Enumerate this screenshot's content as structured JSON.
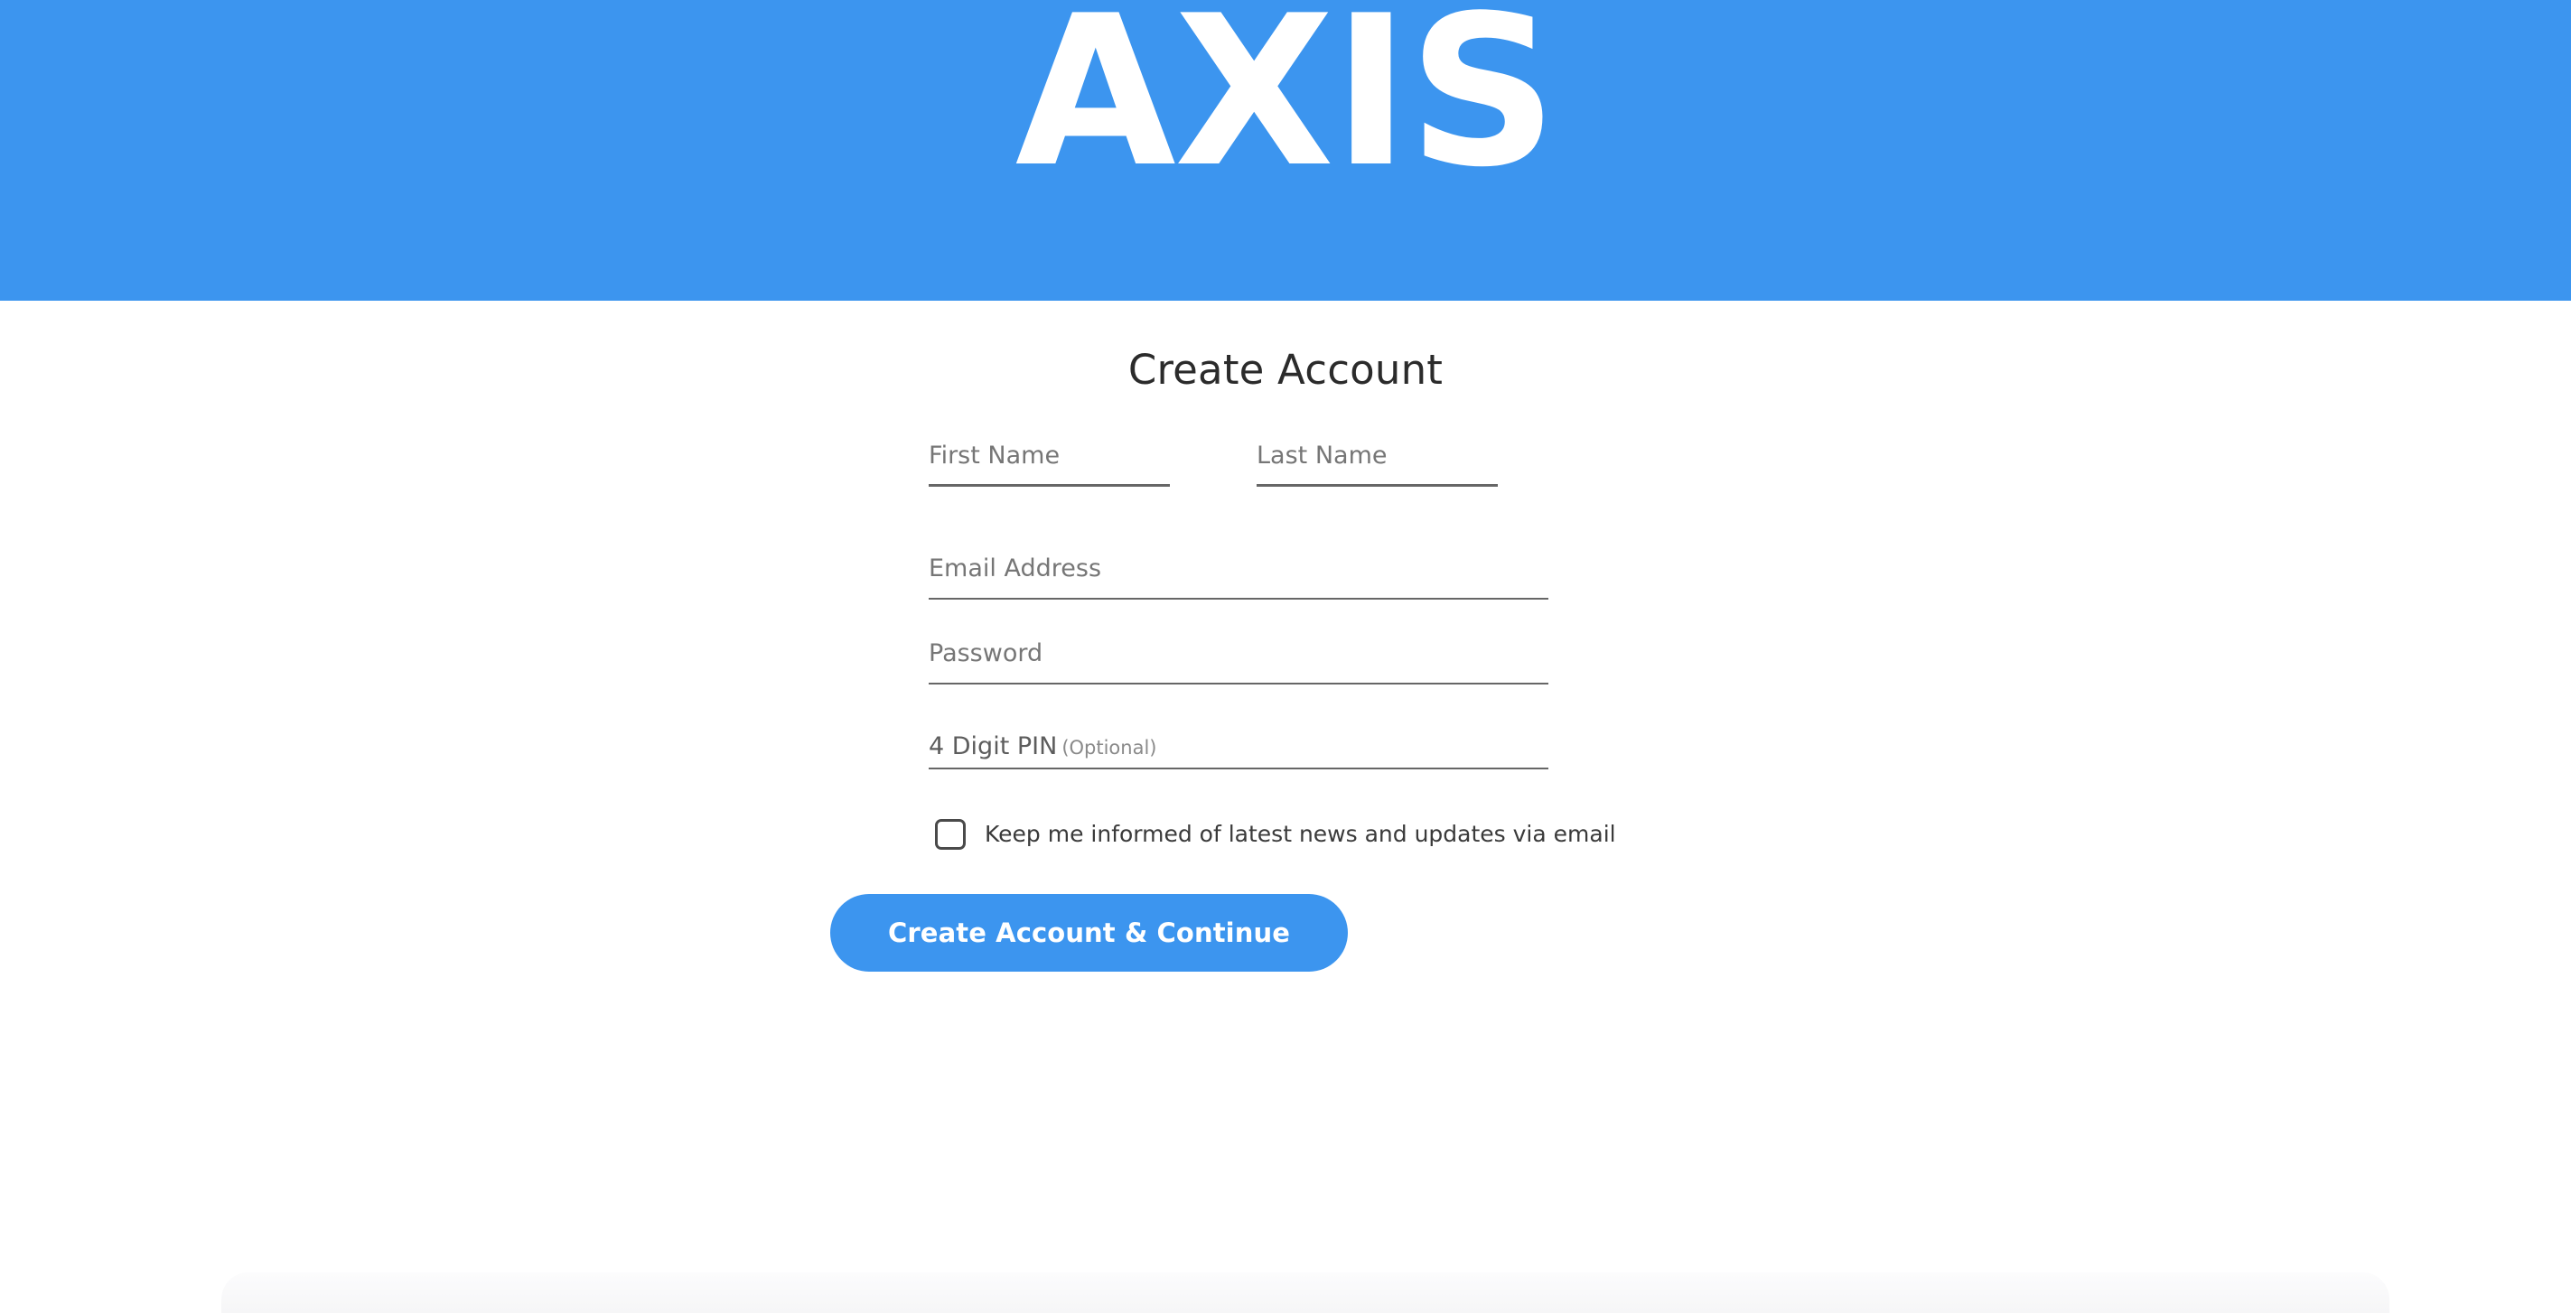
{
  "header": {
    "brand": "AXIS",
    "background_color": "#3c95ef",
    "logo_color": "#ffffff"
  },
  "main": {
    "title": "Create Account",
    "form": {
      "first_name": {
        "label": "First Name",
        "placeholder": "First Name",
        "value": ""
      },
      "last_name": {
        "label": "Last Name",
        "placeholder": "Last Name",
        "value": ""
      },
      "email": {
        "label": "Email Address",
        "placeholder": "Email Address",
        "value": ""
      },
      "password": {
        "label": "Password",
        "placeholder": "Password",
        "value": ""
      },
      "pin": {
        "label": "4 Digit PIN",
        "optional_note": "(Optional)",
        "placeholder": "",
        "value": ""
      },
      "newsletter": {
        "label": "Keep me informed of latest news and updates via email",
        "checked": false
      },
      "submit": {
        "label": "Create Account & Continue",
        "color": "#3c95ef"
      }
    }
  },
  "colors": {
    "accent": "#3c95ef",
    "title_text": "#2b2b2b",
    "placeholder_text": "#767676",
    "field_underline": "#666666",
    "checkbox_border": "#4a4a4a",
    "panel_background": "#f6f6f7"
  }
}
